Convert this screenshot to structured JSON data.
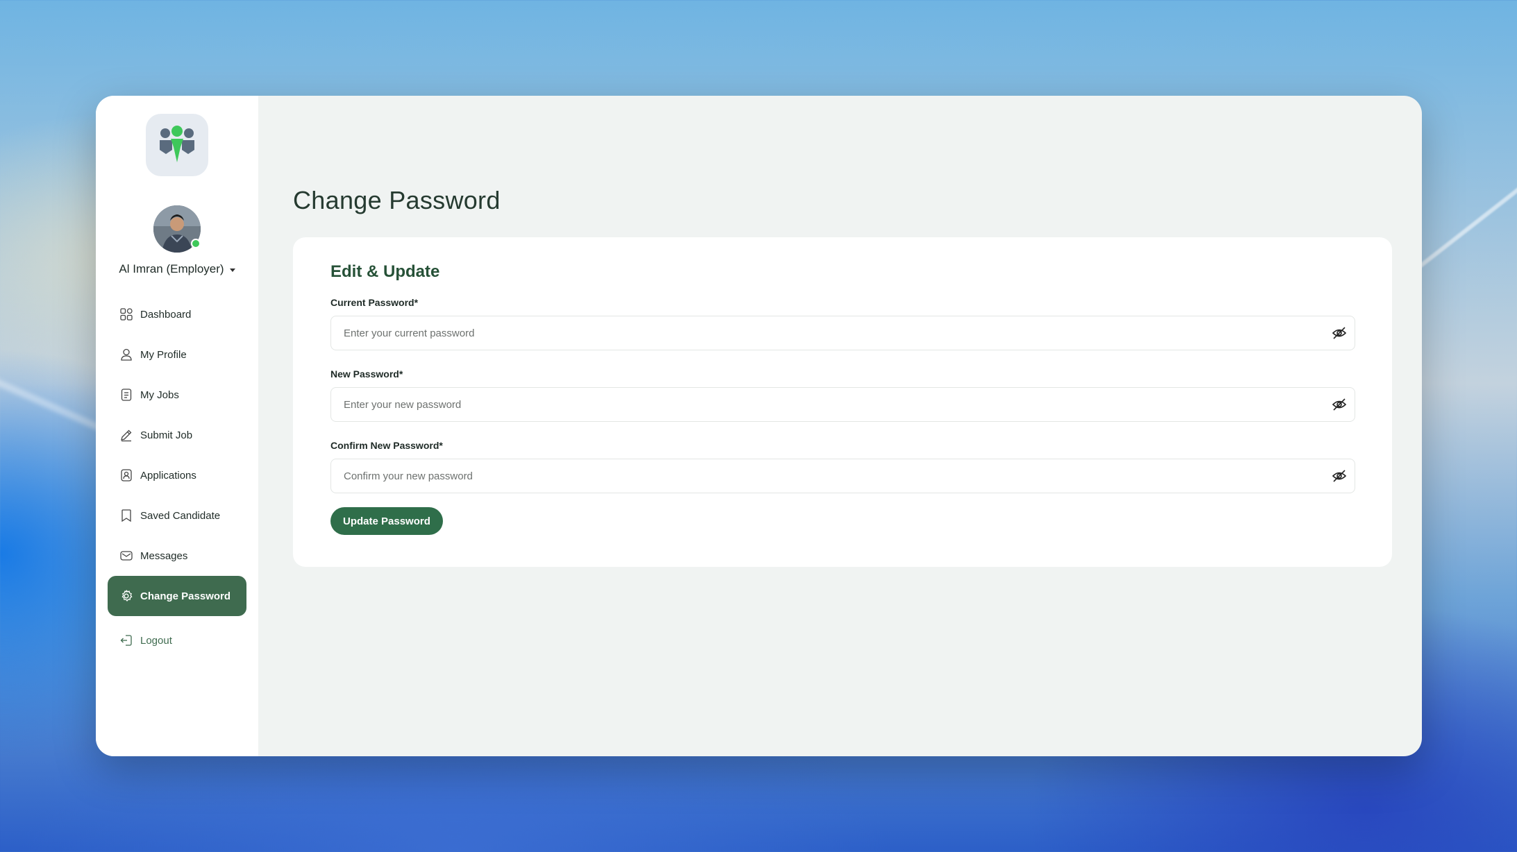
{
  "user": {
    "name": "Al Imran (Employer)"
  },
  "sidebar": {
    "items": [
      {
        "label": "Dashboard",
        "icon": "grid-icon"
      },
      {
        "label": "My Profile",
        "icon": "user-icon"
      },
      {
        "label": "My Jobs",
        "icon": "document-icon"
      },
      {
        "label": "Submit Job",
        "icon": "pen-icon"
      },
      {
        "label": "Applications",
        "icon": "id-badge-icon"
      },
      {
        "label": "Saved Candidate",
        "icon": "bookmark-icon"
      },
      {
        "label": "Messages",
        "icon": "mail-icon"
      },
      {
        "label": "Change Password",
        "icon": "gear-icon",
        "active": true
      }
    ],
    "logout_label": "Logout"
  },
  "main": {
    "title": "Change Password",
    "card": {
      "title": "Edit & Update",
      "fields": [
        {
          "label": "Current Password*",
          "placeholder": "Enter your current password"
        },
        {
          "label": "New Password*",
          "placeholder": "Enter your new password"
        },
        {
          "label": "Confirm New Password*",
          "placeholder": "Confirm your new password"
        }
      ],
      "submit_label": "Update Password"
    }
  },
  "colors": {
    "accent": "#3f6b4f",
    "button": "#2f6e4a",
    "online": "#3ec85a"
  }
}
